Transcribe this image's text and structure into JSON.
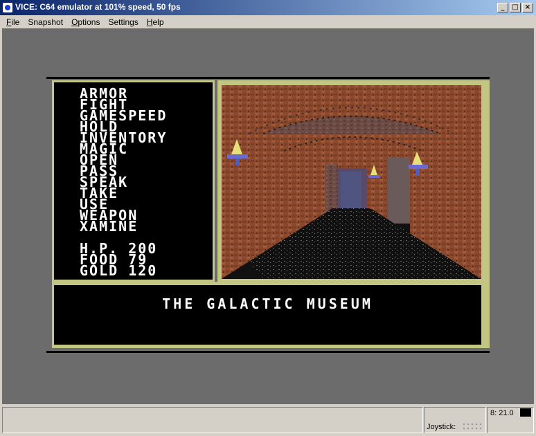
{
  "window": {
    "title": "VICE: C64 emulator at 101% speed, 50 fps"
  },
  "menu": [
    {
      "u": "F",
      "rest": "ile"
    },
    {
      "u": "",
      "rest": "Snapshot"
    },
    {
      "u": "O",
      "rest": "ptions"
    },
    {
      "u": "",
      "rest": "Settings"
    },
    {
      "u": "H",
      "rest": "elp"
    }
  ],
  "game": {
    "commands": [
      "ARMOR",
      "FIGHT",
      "GAMESPEED",
      "HOLD",
      "INVENTORY",
      "MAGIC",
      "OPEN",
      "PASS",
      "SPEAK",
      "TAKE",
      "USE",
      "WEAPON",
      "XAMINE"
    ],
    "stats": [
      {
        "label": "H.P.",
        "value": "200"
      },
      {
        "label": "FOOD",
        "value": "79"
      },
      {
        "label": "GOLD",
        "value": "120"
      }
    ],
    "location": "THE GALACTIC MUSEUM",
    "colors": {
      "frame": "#c3c683",
      "brick": "#8b4a2e",
      "floor": "#1a1a1a"
    }
  },
  "status": {
    "joystick_label": "Joystick:",
    "drive_status": "8: 21.0"
  }
}
